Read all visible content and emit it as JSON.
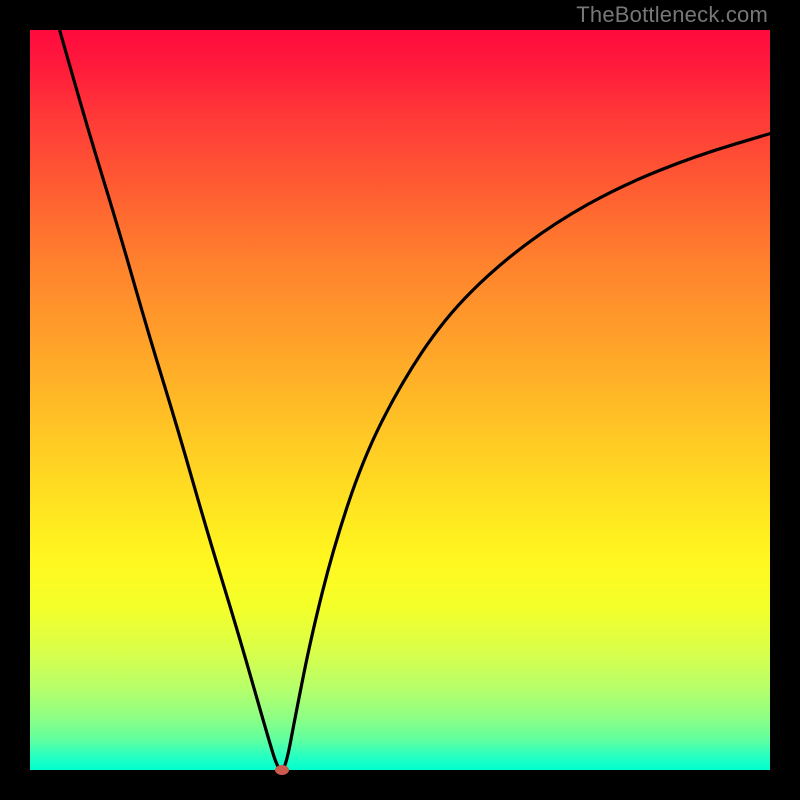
{
  "watermark": "TheBottleneck.com",
  "chart_data": {
    "type": "line",
    "title": "",
    "xlabel": "",
    "ylabel": "",
    "xlim": [
      0,
      100
    ],
    "ylim": [
      0,
      100
    ],
    "grid": false,
    "legend": false,
    "min_marker": {
      "x": 34,
      "y": 0,
      "color": "#cc5b4e"
    },
    "series": [
      {
        "name": "left-branch",
        "x": [
          4,
          8,
          12,
          16,
          20,
          24,
          28,
          32,
          33.5
        ],
        "values": [
          100,
          86,
          73,
          59,
          46,
          32,
          19,
          5,
          0
        ]
      },
      {
        "name": "right-branch",
        "x": [
          34.5,
          36,
          38,
          41,
          45,
          50,
          56,
          63,
          71,
          80,
          90,
          100
        ],
        "values": [
          0,
          8,
          18,
          30,
          42,
          52,
          61,
          68,
          74,
          79,
          83,
          86
        ]
      }
    ]
  },
  "colors": {
    "curve": "#000000",
    "background_top": "#ff0a3e",
    "background_bottom": "#00ffcf",
    "frame": "#000000"
  }
}
